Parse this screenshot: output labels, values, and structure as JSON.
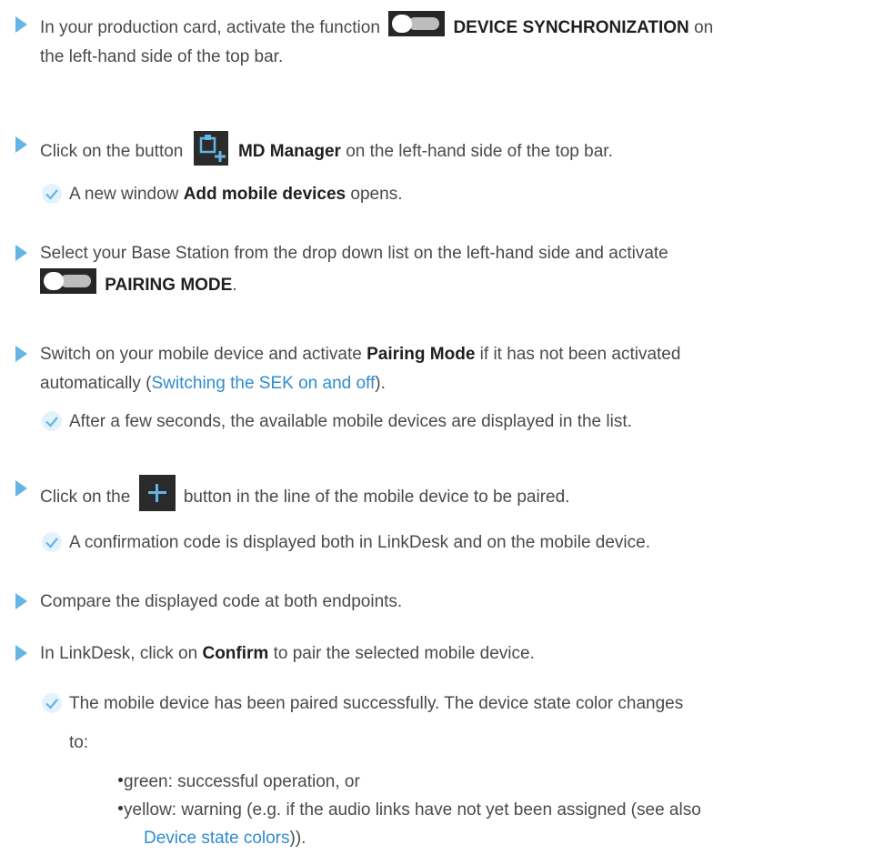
{
  "steps": [
    {
      "pre": "In your production card, activate the function",
      "bold": "DEVICE SYNCHRONIZATION",
      "post": "on",
      "line2": "the left-hand side of the top bar.",
      "icon": "toggle-switch-icon"
    },
    {
      "pre": "Click on the button",
      "bold": "MD Manager",
      "post": "on the left-hand side of the top bar.",
      "icon": "md-manager-icon"
    },
    {
      "pre": "Select your Base Station from the drop down list on the left-hand side and activate",
      "bold": "PAIRING MODE",
      "post": ".",
      "icon": "toggle-switch-icon"
    },
    {
      "pre": "Switch on your mobile device and activate",
      "bold": "Pairing Mode",
      "post": "if it has not been activated",
      "line2_pre": "automatically (",
      "line2_link": "Switching the SEK on and off",
      "line2_post": ")."
    },
    {
      "pre": "Click on the",
      "post": "button in the line of the mobile device to be paired.",
      "icon": "plus-icon"
    },
    {
      "text": "Compare the displayed code at both endpoints."
    },
    {
      "pre": "In LinkDesk, click on",
      "bold": "Confirm",
      "post": "to pair the selected mobile device."
    }
  ],
  "results": [
    {
      "pre": "A new window",
      "bold": "Add mobile devices",
      "post": "opens."
    },
    {
      "text": "After a few seconds, the available mobile devices are displayed in the list."
    },
    {
      "text": "A confirmation code is displayed both in LinkDesk and on the mobile device."
    },
    {
      "line1": "The mobile device has been paired successfully. The device state color changes",
      "line2": "to:"
    }
  ],
  "colors": {
    "list": [
      {
        "text": "green: successful operation, or"
      },
      {
        "text": "yellow: warning (e.g. if the audio links have not yet been assigned (see also"
      }
    ],
    "link": "Device state colors",
    "link_post": "))."
  },
  "palette": {
    "accent": "#64b5e6",
    "link": "#2f8ccf",
    "text": "#4a4a4a"
  }
}
